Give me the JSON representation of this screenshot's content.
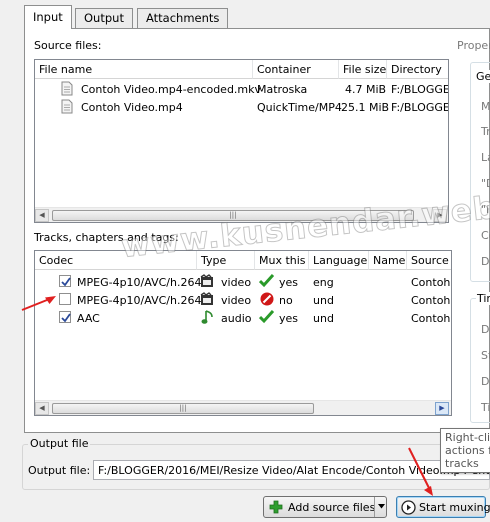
{
  "tabs": [
    {
      "label": "Input"
    },
    {
      "label": "Output"
    },
    {
      "label": "Attachments"
    }
  ],
  "source_files": {
    "label": "Source files:",
    "columns": [
      "File name",
      "Container",
      "File size",
      "Directory"
    ],
    "rows": [
      {
        "name": "Contoh Video.mp4-encoded.mkv",
        "container": "Matroska",
        "size": "4.7 MiB",
        "directory": "F:/BLOGGER"
      },
      {
        "name": "Contoh Video.mp4",
        "container": "QuickTime/MP4",
        "size": "25.1 MiB",
        "directory": "F:/BLOGGER"
      }
    ]
  },
  "tracks": {
    "label": "Tracks, chapters and tags:",
    "columns": [
      "Codec",
      "Type",
      "Mux this",
      "Language",
      "Name",
      "Source f"
    ],
    "rows": [
      {
        "checked": true,
        "codec": "MPEG-4p10/AVC/h.264",
        "type_icon": "film-icon",
        "type": "video",
        "mux_icon": "check-icon",
        "mux": "yes",
        "language": "eng",
        "name": "",
        "source": "Contoh"
      },
      {
        "checked": false,
        "codec": "MPEG-4p10/AVC/h.264",
        "type_icon": "film-icon",
        "type": "video",
        "mux_icon": "no-entry-icon",
        "mux": "no",
        "language": "und",
        "name": "",
        "source": "Contoh"
      },
      {
        "checked": true,
        "codec": "AAC",
        "type_icon": "music-note-icon",
        "type": "audio",
        "mux_icon": "check-icon",
        "mux": "yes",
        "language": "und",
        "name": "",
        "source": "Contoh"
      }
    ]
  },
  "properties": {
    "label": "Proper",
    "group1_title": "Ge",
    "group1_labels": [
      "M",
      "Tr",
      "La",
      "\"D",
      "\"F",
      "Co",
      "De"
    ],
    "group2_title": "Tim",
    "group2_labels": [
      "D",
      "St",
      "D",
      "Ti"
    ]
  },
  "output_file": {
    "group_title": "Output file",
    "label": "Output file:",
    "value": "F:/BLOGGER/2016/MEI/Resize Video/Alat Encode/Contoh Video.mp4-encoded.mkv"
  },
  "tooltip": {
    "lines": [
      "Right-cli",
      "actions f",
      "tracks"
    ]
  },
  "buttons": {
    "add_source_files": "Add source files",
    "start_muxing": "Start muxing"
  },
  "watermark": "www.kusnendar.web.id",
  "colors": {
    "annotation_arrow": "#e02020",
    "checkmark": "#2a9a2a",
    "no_entry": "#d01818",
    "add_icon": "#2f9e2f"
  }
}
